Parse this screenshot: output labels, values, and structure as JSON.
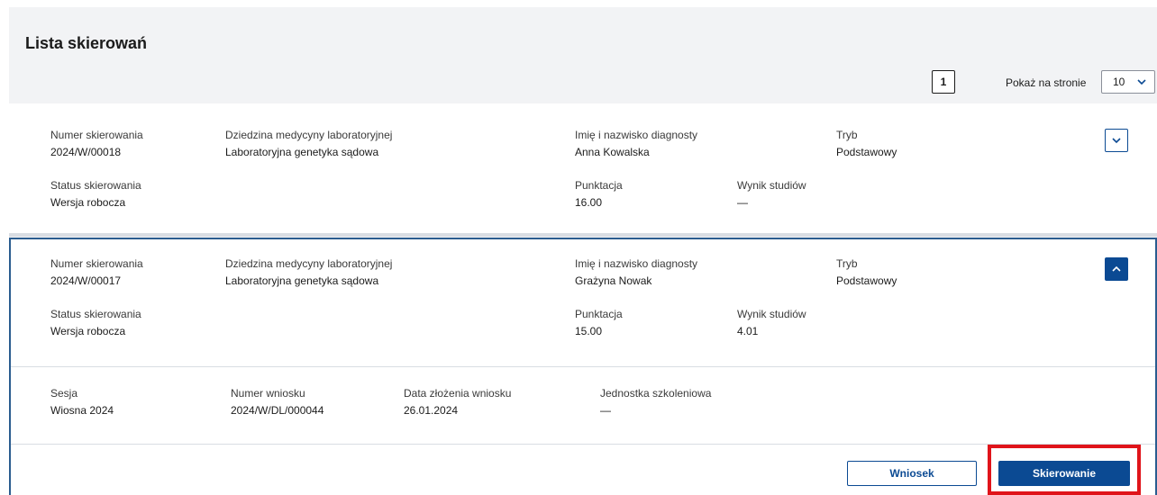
{
  "header": {
    "title": "Lista skierowań",
    "current_page": "1",
    "per_page_label": "Pokaż na stronie",
    "per_page_value": "10"
  },
  "referrals": [
    {
      "number_label": "Numer skierowania",
      "number": "2024/W/00018",
      "field_label": "Dziedzina medycyny laboratoryjnej",
      "field": "Laboratoryjna genetyka sądowa",
      "name_label": "Imię i nazwisko diagnosty",
      "name": "Anna Kowalska",
      "mode_label": "Tryb",
      "mode": "Podstawowy",
      "status_label": "Status skierowania",
      "status": "Wersja robocza",
      "score_label": "Punktacja",
      "score": "16.00",
      "result_label": "Wynik studiów",
      "result": "—"
    },
    {
      "number_label": "Numer skierowania",
      "number": "2024/W/00017",
      "field_label": "Dziedzina medycyny laboratoryjnej",
      "field": "Laboratoryjna genetyka sądowa",
      "name_label": "Imię i nazwisko diagnosty",
      "name": "Grażyna Nowak",
      "mode_label": "Tryb",
      "mode": "Podstawowy",
      "status_label": "Status skierowania",
      "status": "Wersja robocza",
      "score_label": "Punktacja",
      "score": "15.00",
      "result_label": "Wynik studiów",
      "result": "4.01",
      "details": {
        "session_label": "Sesja",
        "session": "Wiosna 2024",
        "application_label": "Numer wniosku",
        "application": "2024/W/DL/000044",
        "date_label": "Data złożenia wniosku",
        "date": "26.01.2024",
        "unit_label": "Jednostka szkoleniowa",
        "unit": "—"
      },
      "actions": {
        "application_button": "Wniosek",
        "referral_button": "Skierowanie"
      }
    }
  ],
  "icons": {
    "collapsed": "chevron-down-icon",
    "expanded": "chevron-up-icon"
  },
  "colors": {
    "primary": "#0b4a93",
    "highlight": "#e0141a",
    "background": "#f2f3f5"
  }
}
